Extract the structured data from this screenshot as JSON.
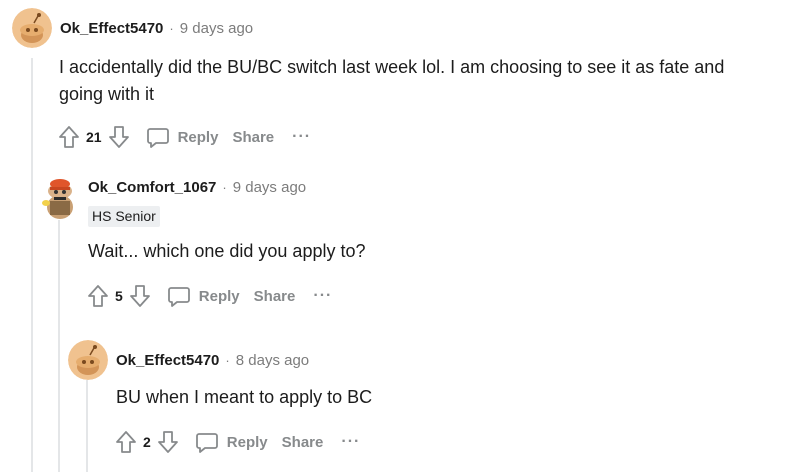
{
  "comments": [
    {
      "username": "Ok_Effect5470",
      "timestamp": "9 days ago",
      "body_line1": "I accidentally did the BU/BC switch last week lol. I am choosing to see it as fate and",
      "body_line2": "going with it",
      "votes": "21",
      "reply_label": "Reply",
      "share_label": "Share",
      "more_label": "···"
    },
    {
      "username": "Ok_Comfort_1067",
      "timestamp": "9 days ago",
      "flair": "HS Senior",
      "body": "Wait... which one did you apply to?",
      "votes": "5",
      "reply_label": "Reply",
      "share_label": "Share",
      "more_label": "···"
    },
    {
      "username": "Ok_Effect5470",
      "timestamp": "8 days ago",
      "body": "BU when I meant to apply to BC",
      "votes": "2",
      "reply_label": "Reply",
      "share_label": "Share",
      "more_label": "···"
    }
  ],
  "separator": "·",
  "colors": {
    "avatar_bg": "#f0c28f",
    "icon_gray": "#878a8c",
    "thread_line": "#e4e6e8",
    "flair_bg": "#edeff1"
  }
}
